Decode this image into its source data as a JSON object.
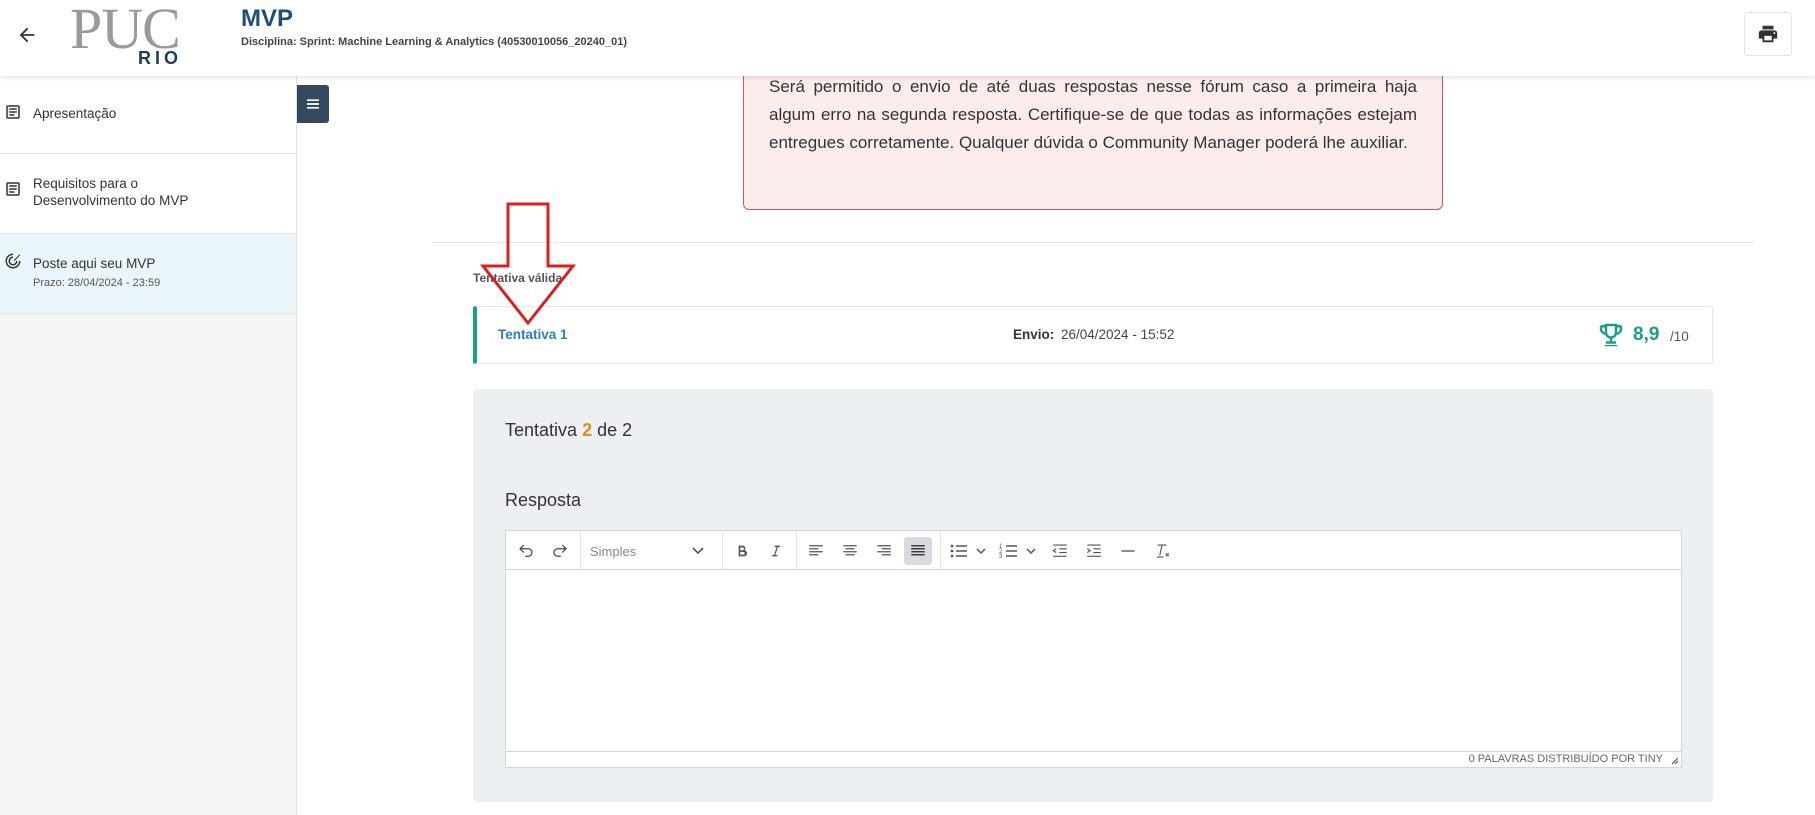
{
  "header": {
    "title": "MVP",
    "subtitle": "Disciplina: Sprint: Machine Learning & Analytics (40530010056_20240_01)",
    "logo_top": "PUC",
    "logo_bottom": "RIO",
    "back_icon": "arrow-left-icon",
    "print_icon": "printer-icon"
  },
  "sidebar": {
    "items": [
      {
        "label": "Apresentação",
        "icon": "document-icon"
      },
      {
        "label": "Requisitos para o",
        "label2": "Desenvolvimento do MVP",
        "icon": "document-icon"
      },
      {
        "label": "Poste aqui seu MVP",
        "sub": "Prazo: 28/04/2024 - 23:59",
        "icon": "target-icon"
      }
    ],
    "collapse_icon": "menu-icon"
  },
  "notice": {
    "text": "Será permitido o envio de até duas respostas nesse fórum caso a primeira haja algum erro na segunda resposta. Certifique-se de que todas as informações estejam entregues corretamente. Qualquer dúvida o Community Manager poderá lhe auxiliar."
  },
  "valid_attempt": {
    "label": "Tentativa válida",
    "attempt_label": "Tentativa 1",
    "send_label": "Envio:",
    "send_value": "26/04/2024 - 15:52",
    "score": "8,9",
    "score_max": "/10",
    "score_icon": "trophy-icon"
  },
  "attempt_panel": {
    "title_prefix": "Tentativa",
    "current": "2",
    "title_suffix": "de 2",
    "answer_label": "Resposta"
  },
  "editor": {
    "format_value": "Simples",
    "status_text": "0 PALAVRAS  DISTRIBUÍDO POR TINY",
    "content": ""
  },
  "colors": {
    "accent": "#1a9e86",
    "link": "#2980b9",
    "title": "#1f4e79",
    "highlight": "#e08e0b",
    "notice_border": "#d9534f",
    "arrow": "#d82020"
  }
}
